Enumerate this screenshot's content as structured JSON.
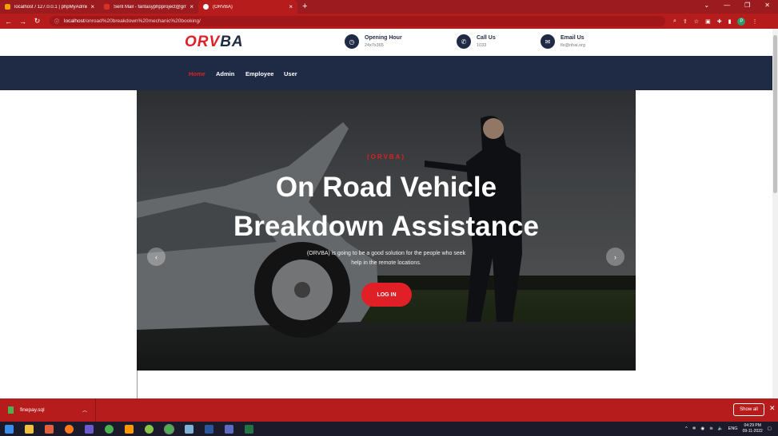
{
  "browser": {
    "tabs": [
      {
        "title": "localhost / 127.0.0.1 | phpMyAdmin",
        "active": false,
        "favicon_color": "#f2a000"
      },
      {
        "title": "Sent Mail - fantasyphpproject@gmail.com",
        "active": false,
        "favicon_color": "#d93025"
      },
      {
        "title": "(ORVBA)",
        "active": true,
        "favicon_color": "#ffffff"
      }
    ],
    "url_host": "localhost",
    "url_path": "/onroad%20breakdown%20mechanic%20booking/",
    "profile_initial": "P"
  },
  "site": {
    "logo_part1": "ORV",
    "logo_part2": "BA",
    "info": [
      {
        "label": "Opening Hour",
        "value": "24x7x365",
        "icon": "clock-icon"
      },
      {
        "label": "Call Us",
        "value": "1033",
        "icon": "phone-icon"
      },
      {
        "label": "Email Us",
        "value": "tls@nhai.org",
        "icon": "email-icon"
      }
    ],
    "nav": [
      "Home",
      "Admin",
      "Employee",
      "User"
    ],
    "active_nav": "Home",
    "colors": {
      "accent": "#e01f26",
      "navy": "#1f2a44"
    }
  },
  "hero": {
    "subtitle": "(ORVBA)",
    "title_line1": "On Road Vehicle",
    "title_line2": "Breakdown Assistance",
    "desc_line1": "(ORVBA) is going to be a good solution for the people who seek",
    "desc_line2": "help in the remote locations.",
    "button": "LOG IN"
  },
  "download": {
    "file": "finepay.sql",
    "show_all": "Show all"
  },
  "taskbar": {
    "lang": "ENG",
    "time": "04:29 PM",
    "date": "09-11-2022"
  }
}
